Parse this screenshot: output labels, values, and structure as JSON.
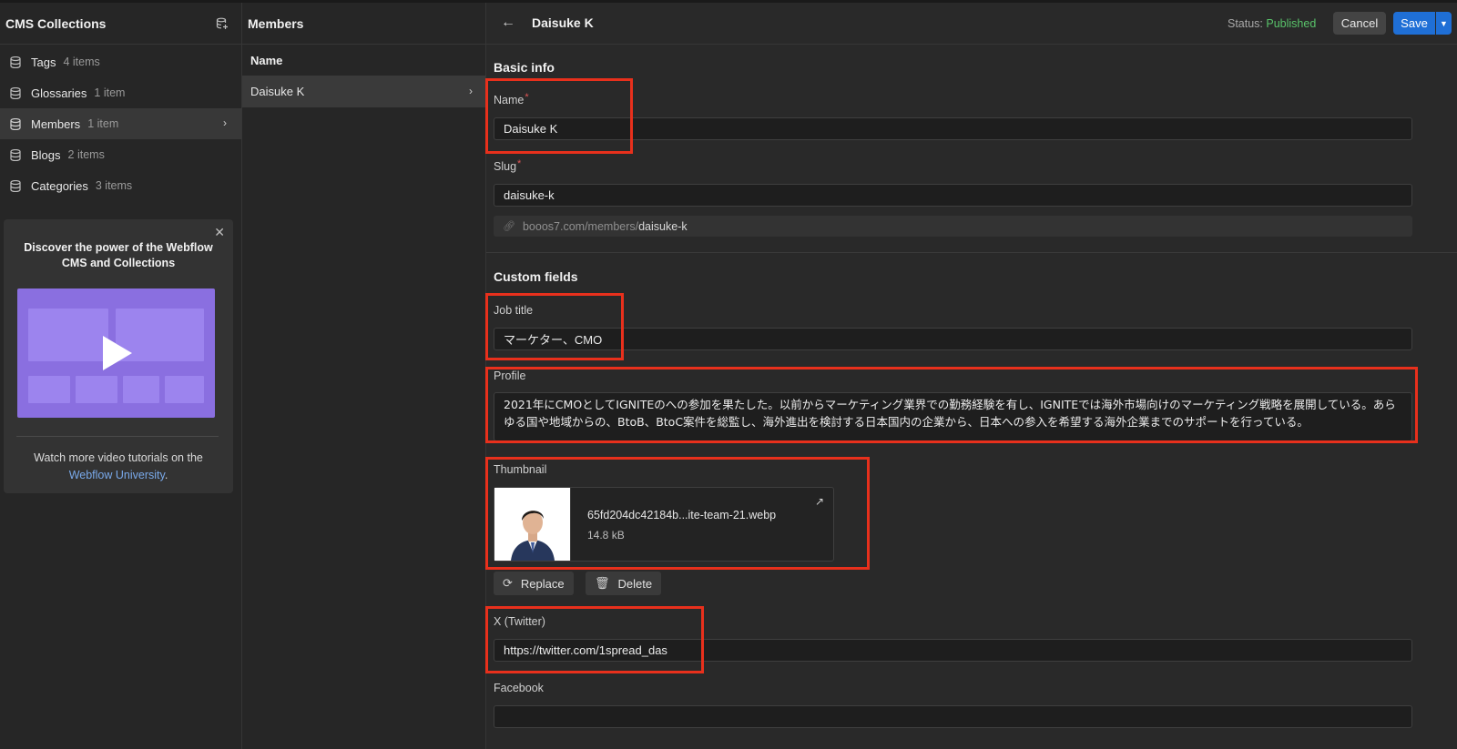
{
  "sidebar": {
    "title": "CMS Collections",
    "collections": [
      {
        "name": "Tags",
        "count": "4 items"
      },
      {
        "name": "Glossaries",
        "count": "1 item"
      },
      {
        "name": "Members",
        "count": "1 item"
      },
      {
        "name": "Blogs",
        "count": "2 items"
      },
      {
        "name": "Categories",
        "count": "3 items"
      }
    ],
    "promo": {
      "title": "Discover the power of the Webflow CMS and Collections",
      "footer_text": "Watch more video tutorials on the",
      "footer_link": "Webflow University",
      "footer_end": "."
    }
  },
  "middle": {
    "title": "Members",
    "column_header": "Name",
    "items": [
      {
        "name": "Daisuke K"
      }
    ]
  },
  "editor": {
    "item_title": "Daisuke K",
    "status_label": "Status: ",
    "status_value": "Published",
    "cancel_label": "Cancel",
    "save_label": "Save",
    "basic_info_title": "Basic info",
    "name_label": "Name",
    "name_value": "Daisuke K",
    "slug_label": "Slug",
    "slug_value": "daisuke-k",
    "url_base": "booos7.com/members/",
    "url_slug": "daisuke-k",
    "custom_fields_title": "Custom fields",
    "job_title_label": "Job title",
    "job_title_value": "マーケター、CMO",
    "profile_label": "Profile",
    "profile_value": "2021年にCMOとしてIGNITEのへの参加を果たした。以前からマーケティング業界での勤務経験を有し、IGNITEでは海外市場向けのマーケティング戦略を展開している。あらゆる国や地域からの、BtoB、BtoC案件を総監し、海外進出を検討する日本国内の企業から、日本への参入を希望する海外企業までのサポートを行っている。",
    "thumbnail_label": "Thumbnail",
    "thumbnail_filename": "65fd204dc42184b...ite-team-21.webp",
    "thumbnail_size": "14.8 kB",
    "replace_label": "Replace",
    "delete_label": "Delete",
    "twitter_label": "X (Twitter)",
    "twitter_value": "https://twitter.com/1spread_das",
    "facebook_label": "Facebook",
    "facebook_value": ""
  },
  "colors": {
    "accent_blue": "#1f6fd6",
    "published_green": "#59c36a",
    "required_red": "#e05555",
    "highlight_red": "#e8301c",
    "video_purple": "#8a6fe0"
  },
  "icons": [
    "add-collection-icon",
    "database-icon",
    "chevron-right-icon",
    "close-icon",
    "play-icon",
    "back-arrow-icon",
    "chevron-down-icon",
    "link-icon",
    "external-link-icon",
    "replace-icon",
    "trash-icon"
  ]
}
